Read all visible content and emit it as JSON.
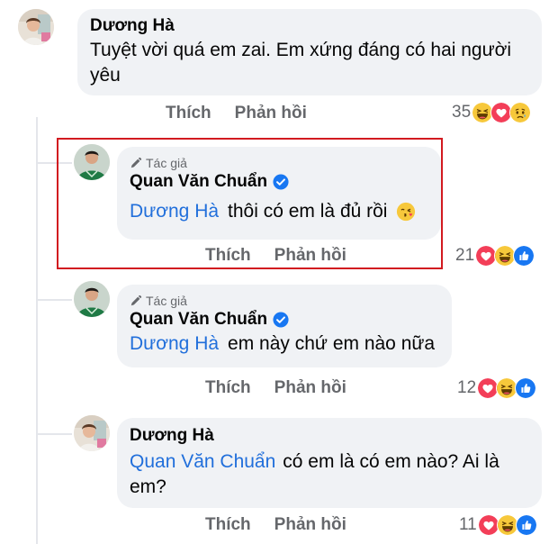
{
  "comments": [
    {
      "name": "Dương Hà",
      "text_lines": [
        "Tuyệt vời quá em zai. Em xứng đáng có hai người",
        "yêu"
      ],
      "like_label": "Thích",
      "reply_label": "Phản hồi",
      "reaction_count": "35",
      "reactions": [
        "haha",
        "love",
        "sad"
      ]
    },
    {
      "author_badge": "Tác giả",
      "name": "Quan Văn Chuẩn",
      "verified": true,
      "mention": "Dương Hà",
      "text": "thôi có em là đủ rồi",
      "like_label": "Thích",
      "reply_label": "Phản hồi",
      "reaction_count": "21",
      "reactions": [
        "love",
        "haha",
        "like"
      ],
      "highlighted": true
    },
    {
      "author_badge": "Tác giả",
      "name": "Quan Văn Chuẩn",
      "verified": true,
      "mention": "Dương Hà",
      "text": "em này chứ em nào nữa",
      "like_label": "Thích",
      "reply_label": "Phản hồi",
      "reaction_count": "12",
      "reactions": [
        "love",
        "haha",
        "like"
      ]
    },
    {
      "name": "Dương Hà",
      "mention": "Quan Văn Chuẩn",
      "text_line1": "có em là có em nào? Ai là",
      "text_line2": "em?",
      "like_label": "Thích",
      "reply_label": "Phản hồi",
      "reaction_count": "11",
      "reactions": [
        "love",
        "haha",
        "like"
      ]
    }
  ],
  "colors": {
    "bubble": "#f0f2f5",
    "mention": "#216fdb",
    "highlight": "#d21a20",
    "secondary_text": "#65676b",
    "verified": "#1877f2"
  },
  "icons": {
    "author_badge": "pencil-icon",
    "verified": "verified-check-icon"
  }
}
